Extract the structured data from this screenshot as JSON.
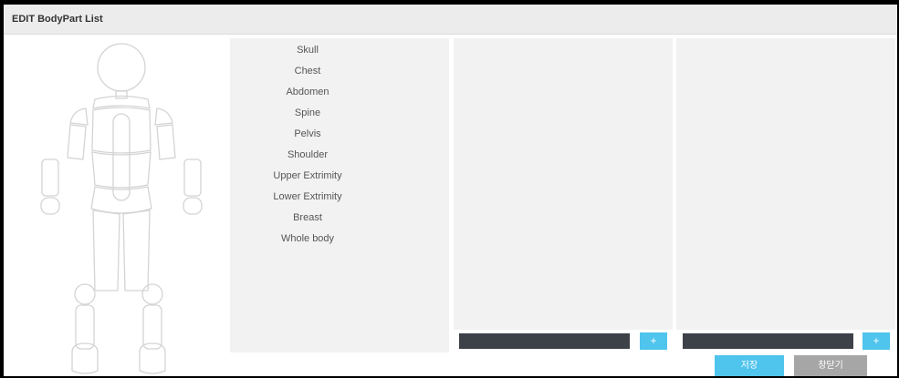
{
  "window": {
    "title": "EDIT BodyPart List"
  },
  "body_parts": [
    {
      "label": "Skull"
    },
    {
      "label": "Chest"
    },
    {
      "label": "Abdomen"
    },
    {
      "label": "Spine"
    },
    {
      "label": "Pelvis"
    },
    {
      "label": "Shoulder"
    },
    {
      "label": "Upper Extrimity"
    },
    {
      "label": "Lower Extrimity"
    },
    {
      "label": "Breast"
    },
    {
      "label": "Whole body"
    }
  ],
  "middle_panel": {
    "input_value": "",
    "add_label": "+"
  },
  "right_panel": {
    "input_value": "",
    "add_label": "+"
  },
  "footer": {
    "save_label": "저장",
    "close_label": "창닫기"
  },
  "colors": {
    "accent": "#4fc4ec",
    "dark_input": "#3d4248",
    "panel_bg": "#f2f2f2",
    "secondary": "#a6a6a6"
  }
}
